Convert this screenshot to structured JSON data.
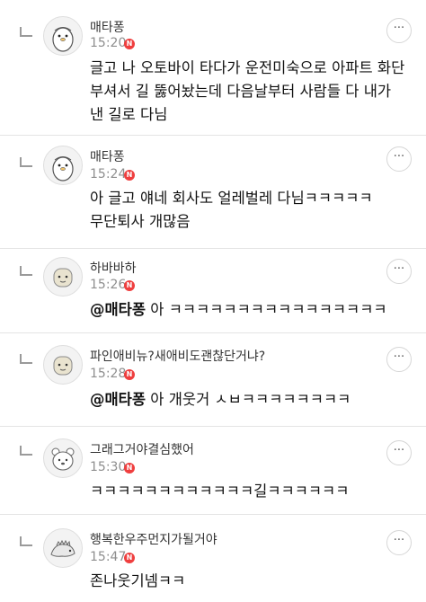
{
  "comments": [
    {
      "nickname": "매타퐁",
      "time": "15:20",
      "new_badge": "N",
      "text": "글고 나 오토바이 타다가 운전미숙으로 아파트 화단 부셔서 길 뚫어놨는데 다음날부터 사람들 다 내가 낸 길로 다님",
      "avatar_icon": "cartoon-penguin-avatar"
    },
    {
      "nickname": "매타퐁",
      "time": "15:24",
      "new_badge": "N",
      "text": "아 글고 얘네 회사도 얼레벌레 다님ㅋㅋㅋㅋㅋ 무단퇴사 개많음",
      "avatar_icon": "cartoon-penguin-avatar"
    },
    {
      "nickname": "하바바하",
      "time": "15:26",
      "new_badge": "N",
      "mention": "@매타퐁",
      "text": "아 ㅋㅋㅋㅋㅋㅋㅋㅋㅋㅋㅋㅋㅋㅋㅋㅋ",
      "avatar_icon": "default-creature-avatar"
    },
    {
      "nickname": "파인애비뉴?새애비도괜찮단거냐?",
      "time": "15:28",
      "new_badge": "N",
      "mention": "@매타퐁",
      "text": "아 개웃거 ㅅㅂㅋㅋㅋㅋㅋㅋㅋㅋ",
      "avatar_icon": "default-creature-avatar"
    },
    {
      "nickname": "그래그거야결심했어",
      "time": "15:30",
      "new_badge": "N",
      "text": "ㅋㅋㅋㅋㅋㅋㅋㅋㅋㅋㅋㅋ길ㅋㅋㅋㅋㅋㅋ",
      "avatar_icon": "bear-avatar"
    },
    {
      "nickname": "행복한우주먼지가될거야",
      "time": "15:47",
      "new_badge": "N",
      "text": "존나웃기넴ㅋㅋ",
      "avatar_icon": "dinosaur-avatar"
    }
  ],
  "more_button_label": "···"
}
